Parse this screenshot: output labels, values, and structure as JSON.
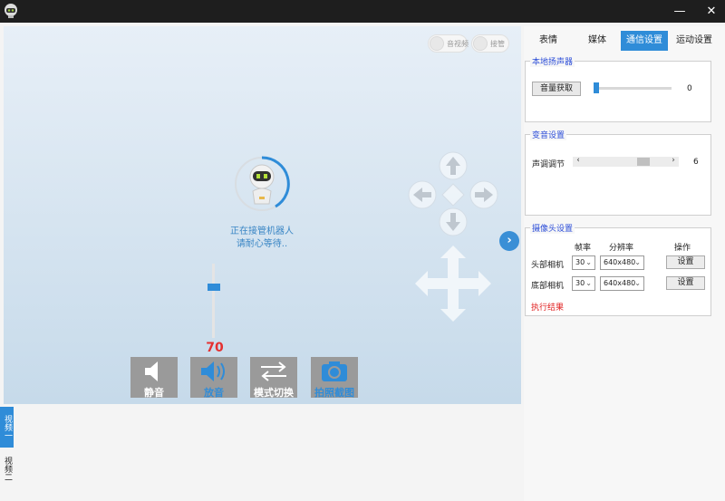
{
  "window": {
    "app_icon": "robot-logo-icon",
    "minimize_label": "—",
    "close_label": "✕"
  },
  "video": {
    "toggle_av_label": "音视频",
    "toggle_takeover_label": "接管",
    "robot_icon": "robot-avatar-icon",
    "status_line1": "正在接管机器人",
    "status_line2": "请耐心等待..",
    "next_arrow": "›",
    "volume_value": "70",
    "volume_level": 0.7,
    "buttons": {
      "mute": "静音",
      "play": "放音",
      "mode": "模式切换",
      "screenshot": "拍照截图"
    }
  },
  "left_tabs": [
    "视频一",
    "视频二"
  ],
  "panel": {
    "tabs": [
      "表情",
      "媒体",
      "通信设置",
      "运动设置"
    ],
    "active_tab": "通信设置",
    "speaker": {
      "title": "本地扬声器",
      "button": "音量获取",
      "value": "0"
    },
    "voice": {
      "title": "变音设置",
      "label": "声调调节",
      "value": "6",
      "arrow_left": "‹",
      "arrow_right": "›"
    },
    "camera": {
      "title": "摄像头设置",
      "header_fps": "帧率",
      "header_res": "分辨率",
      "header_op": "操作",
      "rows": [
        {
          "label": "头部相机",
          "fps": "30",
          "res": "640x480",
          "button": "设置"
        },
        {
          "label": "底部相机",
          "fps": "30",
          "res": "640x480",
          "button": "设置"
        }
      ],
      "result": "执行结果"
    }
  },
  "colors": {
    "accent": "#2f8cd8",
    "title_bar": "#1e1e1e",
    "value_red": "#e53030",
    "group_title": "#2e4fd8"
  }
}
